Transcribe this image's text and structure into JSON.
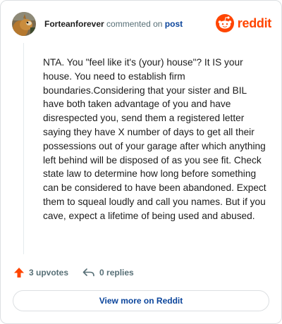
{
  "header": {
    "username": "Forteanforever",
    "action_text": "commented on",
    "post_link": "post",
    "logo_text": "reddit",
    "avatar_icon": "squirrel-avatar"
  },
  "comment": {
    "body": "NTA. You \"feel like it's (your) house\"? It IS your house. You need to establish firm boundaries.Considering that your sister and BIL have both taken advantage of you and have disrespected you, send them a registered letter saying they have X number of days to get all their possessions out of your garage after which anything left behind will be disposed of as you see fit. Check state law to determine how long before something can be considered to have been abandoned. Expect them to squeal loudly and call you names. But if you cave, expect a lifetime of being used and abused."
  },
  "actions": {
    "upvotes": "3 upvotes",
    "replies": "0 replies"
  },
  "footer": {
    "view_more": "View more on Reddit"
  },
  "colors": {
    "brand": "#ff4500",
    "link": "#0a449b",
    "muted": "#576f76"
  }
}
